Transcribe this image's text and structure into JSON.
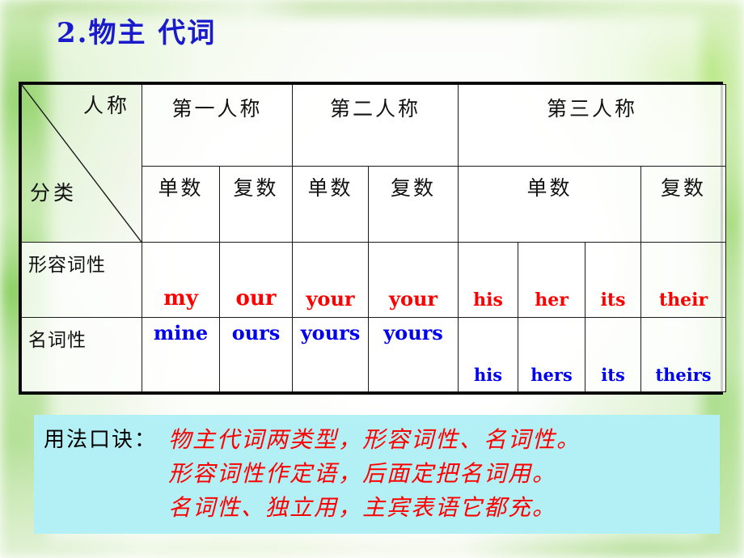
{
  "slide": {
    "title": "2.物主 代词",
    "title_color": "#1a1acd"
  },
  "table": {
    "corner": {
      "top_label": "人称",
      "bottom_label": "分类"
    },
    "person_headers": [
      "第一人称",
      "第二人称",
      "第三人称"
    ],
    "number_headers": {
      "first_singular": "单数",
      "first_plural": "复数",
      "second_singular": "单数",
      "second_plural": "复数",
      "third_singular": "单数",
      "third_plural": "复数"
    },
    "rows": [
      {
        "label": "形容词性",
        "color": "#ff0000",
        "cells": [
          "my",
          "our",
          "your",
          "your",
          "his",
          "her",
          "its",
          "their"
        ]
      },
      {
        "label": "名词性",
        "color": "#0000ee",
        "cells": [
          "mine",
          "ours",
          "yours",
          "yours",
          "his",
          "hers",
          "its",
          "theirs"
        ]
      }
    ]
  },
  "caption": {
    "label": "用法口诀：",
    "background": "#b3f0f5",
    "text_color": "#ff0000",
    "lines": [
      "物主代词两类型，形容词性、名词性。",
      "形容词性作定语，后面定把名词用。",
      "名词性、独立用，主宾表语它都充。"
    ]
  }
}
